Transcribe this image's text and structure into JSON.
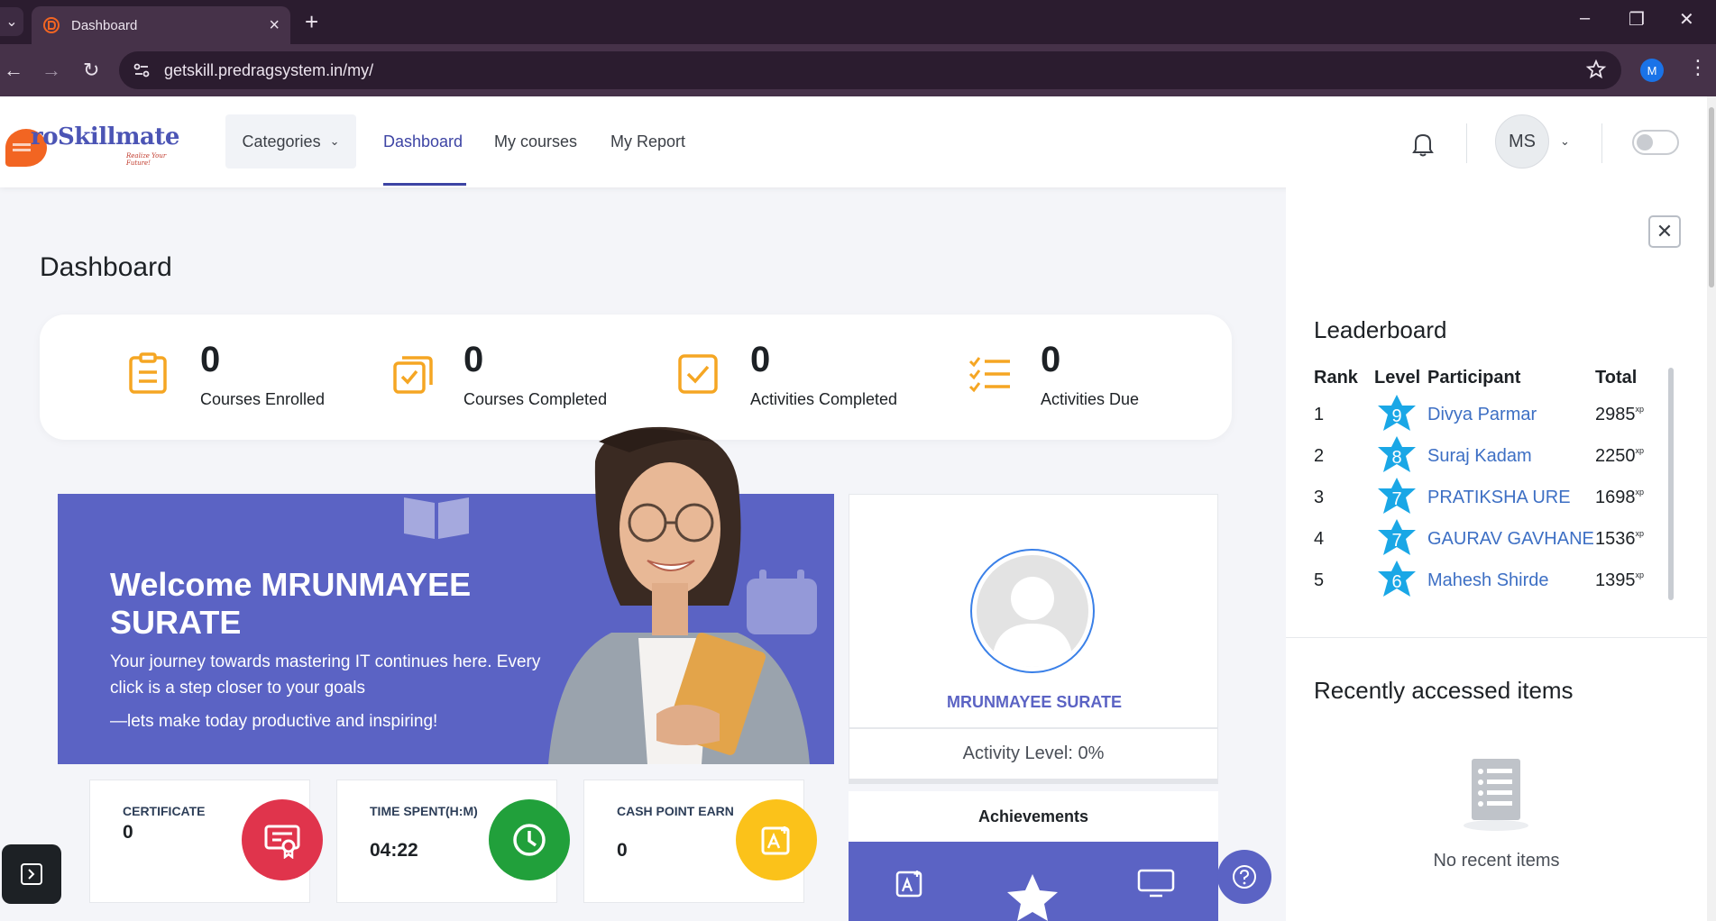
{
  "browser": {
    "tab_title": "Dashboard",
    "url": "getskill.predragsystem.in/my/",
    "profile_initial": "M"
  },
  "header": {
    "logo_text": "roSkillmate",
    "logo_tagline": "Realize Your Future!",
    "categories_label": "Categories",
    "nav": [
      {
        "label": "Dashboard",
        "active": true
      },
      {
        "label": "My courses",
        "active": false
      },
      {
        "label": "My Report",
        "active": false
      }
    ],
    "user_initials": "MS"
  },
  "main": {
    "page_title": "Dashboard",
    "stats": [
      {
        "value": "0",
        "label": "Courses Enrolled",
        "icon": "clipboard-list-icon"
      },
      {
        "value": "0",
        "label": "Courses Completed",
        "icon": "clipboard-check-stack-icon"
      },
      {
        "value": "0",
        "label": "Activities Completed",
        "icon": "checkbox-icon"
      },
      {
        "value": "0",
        "label": "Activities Due",
        "icon": "checklist-icon"
      }
    ],
    "welcome": {
      "heading": "Welcome MRUNMAYEE SURATE",
      "line1": "Your journey towards mastering IT continues here. Every click is a step closer to your goals",
      "line2": "—lets make today productive and inspiring!"
    },
    "mini_cards": [
      {
        "title": "CERTIFICATE",
        "value": "0",
        "color": "#e0344c",
        "icon": "certificate-icon"
      },
      {
        "title": "TIME SPENT(H:M)",
        "value": "04:22",
        "color": "#21a03b",
        "icon": "clock-icon"
      },
      {
        "title": "CASH POINT EARN",
        "value": "0",
        "color": "#fbc21a",
        "icon": "grade-icon"
      }
    ],
    "profile": {
      "name": "MRUNMAYEE SURATE",
      "activity_level": "Activity Level: 0%",
      "achievements_label": "Achievements"
    }
  },
  "drawer": {
    "leaderboard_title": "Leaderboard",
    "columns": {
      "rank": "Rank",
      "level": "Level",
      "participant": "Participant",
      "total": "Total"
    },
    "xp_suffix": "xp",
    "rows": [
      {
        "rank": "1",
        "level": "9",
        "name": "Divya Parmar",
        "total": "2985"
      },
      {
        "rank": "2",
        "level": "8",
        "name": "Suraj Kadam",
        "total": "2250"
      },
      {
        "rank": "3",
        "level": "7",
        "name": "PRATIKSHA URE",
        "total": "1698"
      },
      {
        "rank": "4",
        "level": "7",
        "name": "GAURAV GAVHANE",
        "total": "1536"
      },
      {
        "rank": "5",
        "level": "6",
        "name": "Mahesh Shirde",
        "total": "1395"
      }
    ],
    "recent_title": "Recently accessed items",
    "recent_empty": "No recent items"
  },
  "colors": {
    "brand": "#5b63c4",
    "nav_active": "#3d44a4",
    "stat_icon": "#f5a623",
    "level_star": "#1aa7e6"
  }
}
